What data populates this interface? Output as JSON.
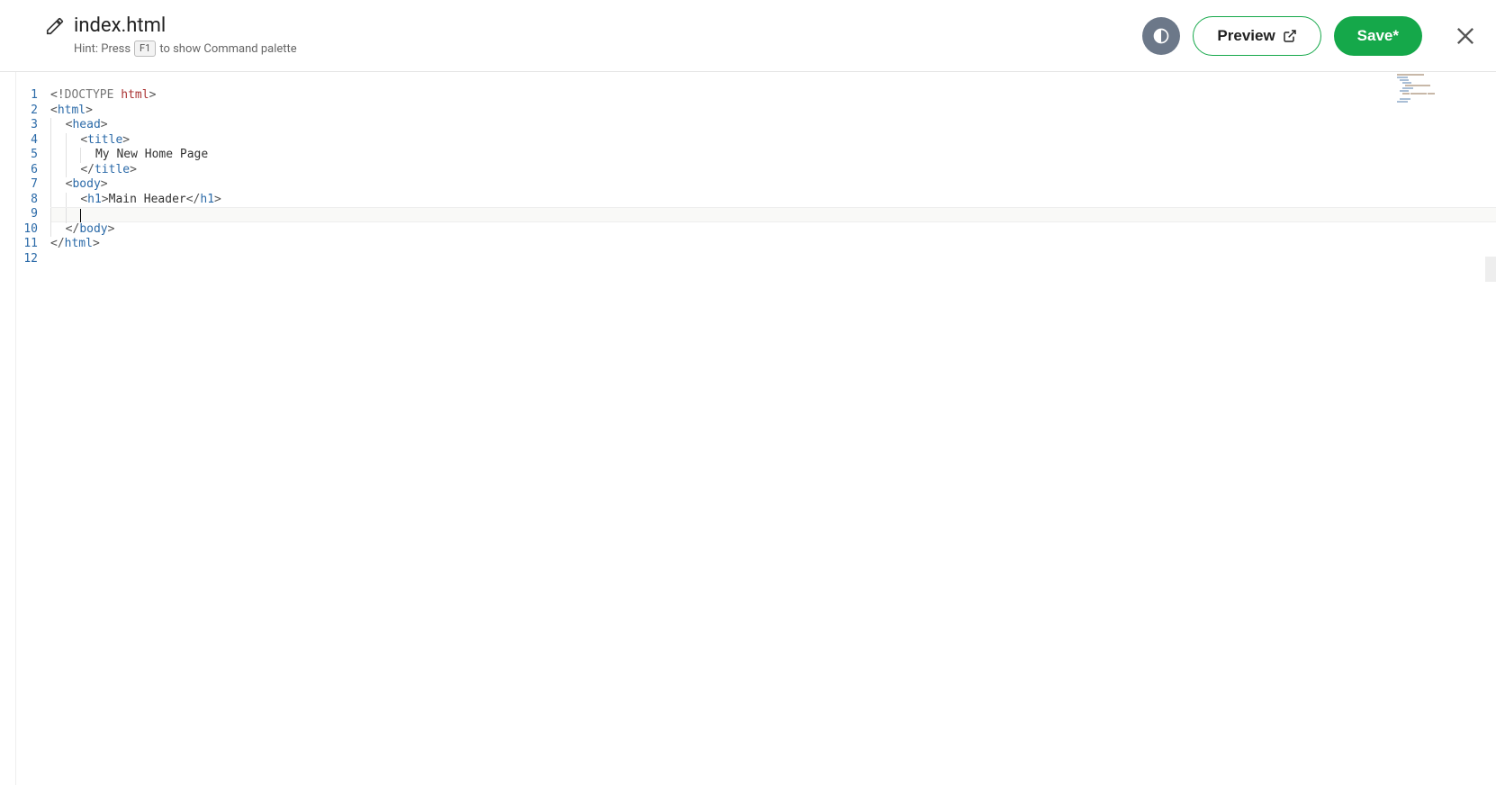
{
  "header": {
    "filename": "index.html",
    "hint_prefix": "Hint: Press",
    "hint_key": "F1",
    "hint_suffix": "to show Command palette"
  },
  "actions": {
    "preview_label": "Preview",
    "save_label": "Save*"
  },
  "editor": {
    "line_numbers": [
      "1",
      "2",
      "3",
      "4",
      "5",
      "6",
      "7",
      "8",
      "9",
      "10",
      "11",
      "12"
    ],
    "code_lines": [
      {
        "indent": 0,
        "tokens": [
          {
            "t": "<!",
            "c": "tok-bracket"
          },
          {
            "t": "DOCTYPE ",
            "c": "tok-doctype"
          },
          {
            "t": "html",
            "c": "tok-attr"
          },
          {
            "t": ">",
            "c": "tok-bracket"
          }
        ]
      },
      {
        "indent": 0,
        "tokens": [
          {
            "t": "<",
            "c": "tok-bracket"
          },
          {
            "t": "html",
            "c": "tok-tag"
          },
          {
            "t": ">",
            "c": "tok-bracket"
          }
        ]
      },
      {
        "indent": 1,
        "tokens": [
          {
            "t": "<",
            "c": "tok-bracket"
          },
          {
            "t": "head",
            "c": "tok-tag"
          },
          {
            "t": ">",
            "c": "tok-bracket"
          }
        ]
      },
      {
        "indent": 2,
        "tokens": [
          {
            "t": "<",
            "c": "tok-bracket"
          },
          {
            "t": "title",
            "c": "tok-tag"
          },
          {
            "t": ">",
            "c": "tok-bracket"
          }
        ]
      },
      {
        "indent": 3,
        "tokens": [
          {
            "t": "My New Home Page",
            "c": "tok-text"
          }
        ]
      },
      {
        "indent": 2,
        "tokens": [
          {
            "t": "</",
            "c": "tok-bracket"
          },
          {
            "t": "title",
            "c": "tok-tag"
          },
          {
            "t": ">",
            "c": "tok-bracket"
          }
        ]
      },
      {
        "indent": 1,
        "tokens": [
          {
            "t": "<",
            "c": "tok-bracket"
          },
          {
            "t": "body",
            "c": "tok-tag"
          },
          {
            "t": ">",
            "c": "tok-bracket"
          }
        ]
      },
      {
        "indent": 2,
        "tokens": [
          {
            "t": "<",
            "c": "tok-bracket"
          },
          {
            "t": "h1",
            "c": "tok-tag"
          },
          {
            "t": ">",
            "c": "tok-bracket"
          },
          {
            "t": "Main Header",
            "c": "tok-text"
          },
          {
            "t": "</",
            "c": "tok-bracket"
          },
          {
            "t": "h1",
            "c": "tok-tag"
          },
          {
            "t": ">",
            "c": "tok-bracket"
          }
        ]
      },
      {
        "indent": 2,
        "tokens": [],
        "current": true,
        "cursor": true
      },
      {
        "indent": 1,
        "tokens": [
          {
            "t": "</",
            "c": "tok-bracket"
          },
          {
            "t": "body",
            "c": "tok-tag"
          },
          {
            "t": ">",
            "c": "tok-bracket"
          }
        ]
      },
      {
        "indent": 0,
        "tokens": [
          {
            "t": "</",
            "c": "tok-bracket"
          },
          {
            "t": "html",
            "c": "tok-tag"
          },
          {
            "t": ">",
            "c": "tok-bracket"
          }
        ]
      },
      {
        "indent": 0,
        "tokens": []
      }
    ]
  }
}
